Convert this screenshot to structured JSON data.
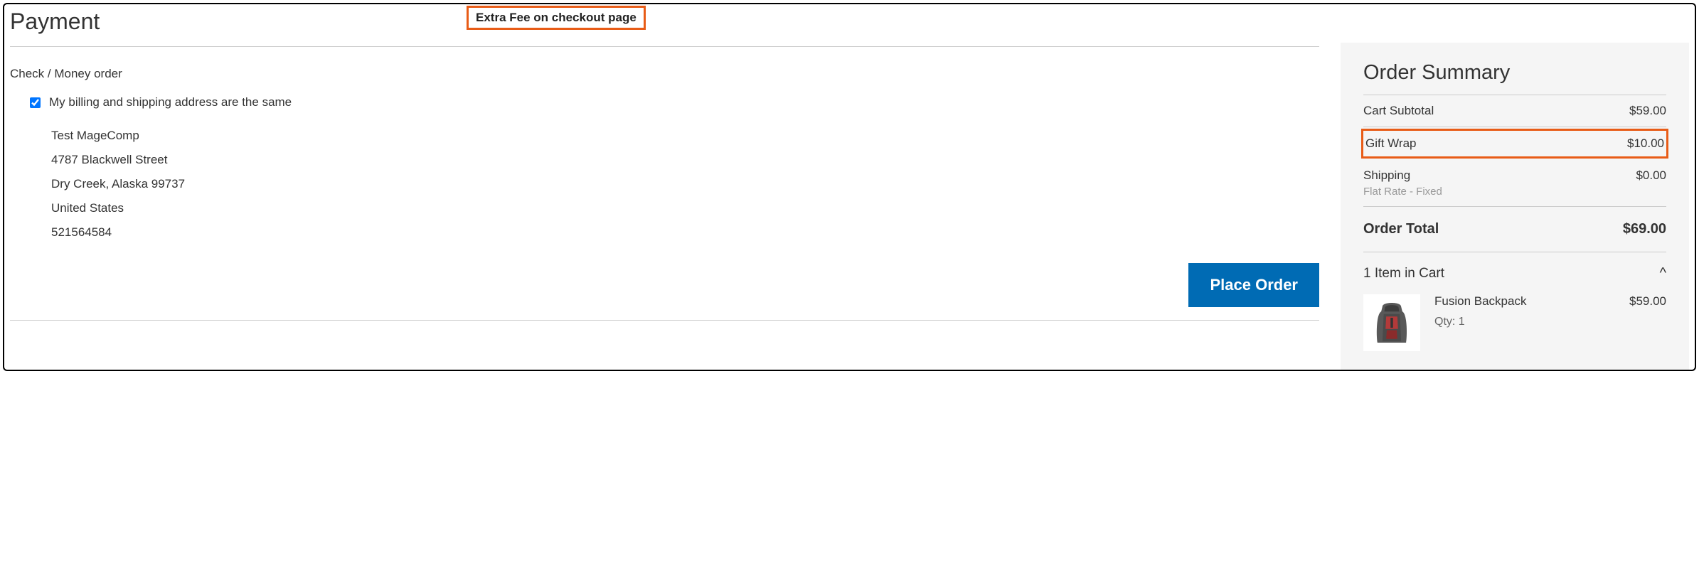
{
  "callout": "Extra Fee on checkout page",
  "page": {
    "title": "Payment"
  },
  "paymentMethod": {
    "title": "Check / Money order"
  },
  "billingSame": {
    "checked": true,
    "label": "My billing and shipping address are the same"
  },
  "address": {
    "name": "Test MageComp",
    "street": "4787 Blackwell Street",
    "cityRegionZip": "Dry Creek, Alaska 99737",
    "country": "United States",
    "phone": "521564584"
  },
  "actions": {
    "placeOrder": "Place Order"
  },
  "summary": {
    "title": "Order Summary",
    "lines": {
      "subtotal": {
        "label": "Cart Subtotal",
        "value": "$59.00"
      },
      "giftwrap": {
        "label": "Gift Wrap",
        "value": "$10.00"
      },
      "shipping": {
        "label": "Shipping",
        "sub": "Flat Rate - Fixed",
        "value": "$0.00"
      }
    },
    "total": {
      "label": "Order Total",
      "value": "$69.00"
    },
    "cartToggle": "1 Item in Cart",
    "item": {
      "name": "Fusion Backpack",
      "qtyLabel": "Qty:",
      "qty": "1",
      "price": "$59.00"
    }
  }
}
